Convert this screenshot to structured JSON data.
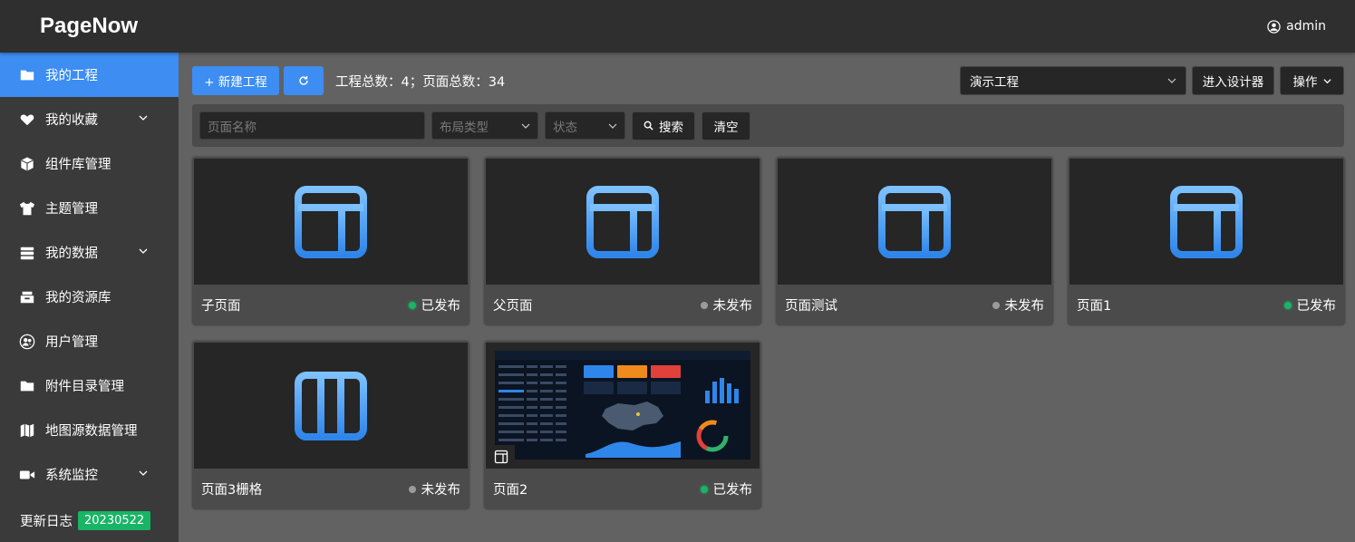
{
  "app": {
    "title": "PageNow",
    "user": "admin"
  },
  "sidebar": {
    "items": [
      {
        "label": "我的工程",
        "icon": "folder-icon",
        "active": true,
        "expandable": false
      },
      {
        "label": "我的收藏",
        "icon": "heart-icon",
        "active": false,
        "expandable": true
      },
      {
        "label": "组件库管理",
        "icon": "cube-icon",
        "active": false,
        "expandable": false
      },
      {
        "label": "主题管理",
        "icon": "shirt-icon",
        "active": false,
        "expandable": false
      },
      {
        "label": "我的数据",
        "icon": "database-icon",
        "active": false,
        "expandable": true
      },
      {
        "label": "我的资源库",
        "icon": "archive-icon",
        "active": false,
        "expandable": false
      },
      {
        "label": "用户管理",
        "icon": "users-icon",
        "active": false,
        "expandable": false
      },
      {
        "label": "附件目录管理",
        "icon": "folder-icon",
        "active": false,
        "expandable": false
      },
      {
        "label": "地图源数据管理",
        "icon": "map-icon",
        "active": false,
        "expandable": false
      },
      {
        "label": "系统监控",
        "icon": "video-camera-icon",
        "active": false,
        "expandable": true
      }
    ],
    "changelog_label": "更新日志",
    "version": "20230522"
  },
  "toolbar": {
    "new_project_label": "+ 新建工程",
    "stats_text": "工程总数：4；页面总数：34",
    "project_select_value": "演示工程",
    "designer_label": "进入设计器",
    "ops_label": "操作"
  },
  "filters": {
    "page_name_placeholder": "页面名称",
    "layout_type_placeholder": "布局类型",
    "status_placeholder": "状态",
    "search_label": "搜索",
    "clear_label": "清空"
  },
  "pages": [
    {
      "name": "子页面",
      "status": "已发布",
      "published": true,
      "thumb": "layout-split-icon"
    },
    {
      "name": "父页面",
      "status": "未发布",
      "published": false,
      "thumb": "layout-split-icon"
    },
    {
      "name": "页面测试",
      "status": "未发布",
      "published": false,
      "thumb": "layout-split-icon"
    },
    {
      "name": "页面1",
      "status": "已发布",
      "published": true,
      "thumb": "layout-split-icon"
    },
    {
      "name": "页面3栅格",
      "status": "未发布",
      "published": false,
      "thumb": "layout-columns-icon"
    },
    {
      "name": "页面2",
      "status": "已发布",
      "published": true,
      "thumb": "dashboard-screenshot"
    }
  ],
  "colors": {
    "accent": "#3d8df2",
    "published": "#19b466",
    "unpublished": "#9b9b9b",
    "header_bg": "#2f2f2f",
    "sidebar_bg": "#3a3a3a",
    "main_bg": "#626262"
  }
}
